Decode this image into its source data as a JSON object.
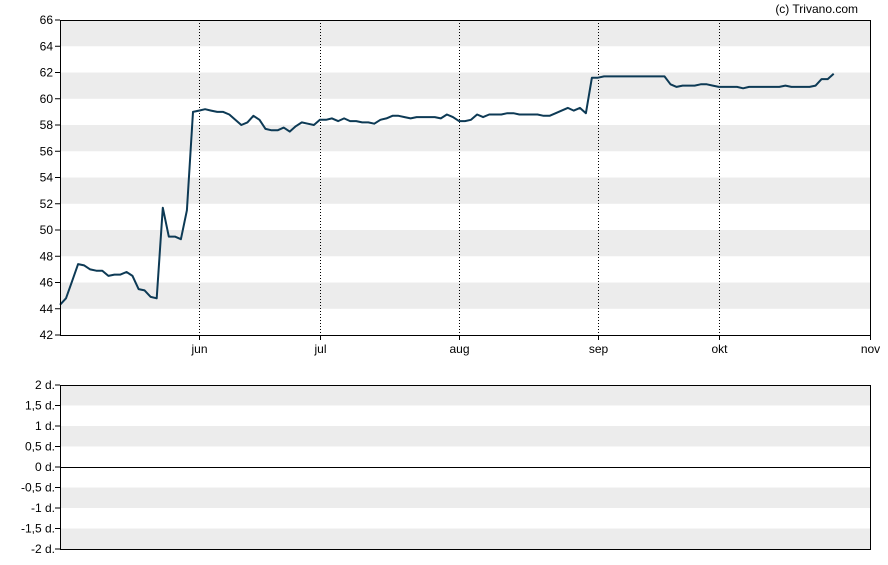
{
  "credit": "(c) Trivano.com",
  "colors": {
    "line": "#0d3a55",
    "band": "#ececec",
    "frame": "#000000",
    "background": "#ffffff"
  },
  "chart_data": [
    {
      "type": "line",
      "title": "",
      "xlabel": "",
      "ylabel": "",
      "ylim": [
        42,
        66
      ],
      "yticks": [
        "42",
        "44",
        "46",
        "48",
        "50",
        "52",
        "54",
        "56",
        "58",
        "60",
        "62",
        "64",
        "66"
      ],
      "xtick_labels": [
        "jun",
        "jul",
        "aug",
        "sep",
        "okt",
        "nov"
      ],
      "xtick_index": [
        23,
        43,
        66,
        89,
        109,
        134
      ],
      "x_points": 135,
      "vertical_grid": "dotted at month starts",
      "bands": "alternating grey/white every 2 units",
      "series": [
        {
          "values": [
            44.3,
            44.8,
            46.1,
            47.4,
            47.3,
            47.0,
            46.9,
            46.9,
            46.5,
            46.6,
            46.6,
            46.8,
            46.5,
            45.5,
            45.4,
            44.9,
            44.8,
            51.7,
            49.5,
            49.5,
            49.3,
            51.5,
            59.0,
            59.1,
            59.2,
            59.1,
            59.0,
            59.0,
            58.8,
            58.4,
            58.0,
            58.2,
            58.7,
            58.4,
            57.7,
            57.6,
            57.6,
            57.8,
            57.5,
            57.9,
            58.2,
            58.1,
            58.0,
            58.4,
            58.4,
            58.5,
            58.3,
            58.5,
            58.3,
            58.3,
            58.2,
            58.2,
            58.1,
            58.4,
            58.5,
            58.7,
            58.7,
            58.6,
            58.5,
            58.6,
            58.6,
            58.6,
            58.6,
            58.5,
            58.8,
            58.6,
            58.3,
            58.3,
            58.4,
            58.8,
            58.6,
            58.8,
            58.8,
            58.8,
            58.9,
            58.9,
            58.8,
            58.8,
            58.8,
            58.8,
            58.7,
            58.7,
            58.9,
            59.1,
            59.3,
            59.1,
            59.3,
            58.9,
            61.6,
            61.6,
            61.7,
            61.7,
            61.7,
            61.7,
            61.7,
            61.7,
            61.7,
            61.7,
            61.7,
            61.7,
            61.7,
            61.1,
            60.9,
            61.0,
            61.0,
            61.0,
            61.1,
            61.1,
            61.0,
            60.9,
            60.9,
            60.9,
            60.9,
            60.8,
            60.9,
            60.9,
            60.9,
            60.9,
            60.9,
            60.9,
            61.0,
            60.9,
            60.9,
            60.9,
            60.9,
            61.0,
            61.5,
            61.5,
            61.9
          ]
        }
      ]
    },
    {
      "type": "line",
      "title": "",
      "xlabel": "",
      "ylabel": "",
      "ylim": [
        -2,
        2
      ],
      "yticks": [
        "-2 d.",
        "-1,5 d.",
        "-1 d.",
        "-0,5 d.",
        "0 d.",
        "0,5 d.",
        "1 d.",
        "1,5 d.",
        "2 d."
      ],
      "bands": "alternating grey/white every 0.5 units",
      "baseline": 0,
      "series": []
    }
  ]
}
